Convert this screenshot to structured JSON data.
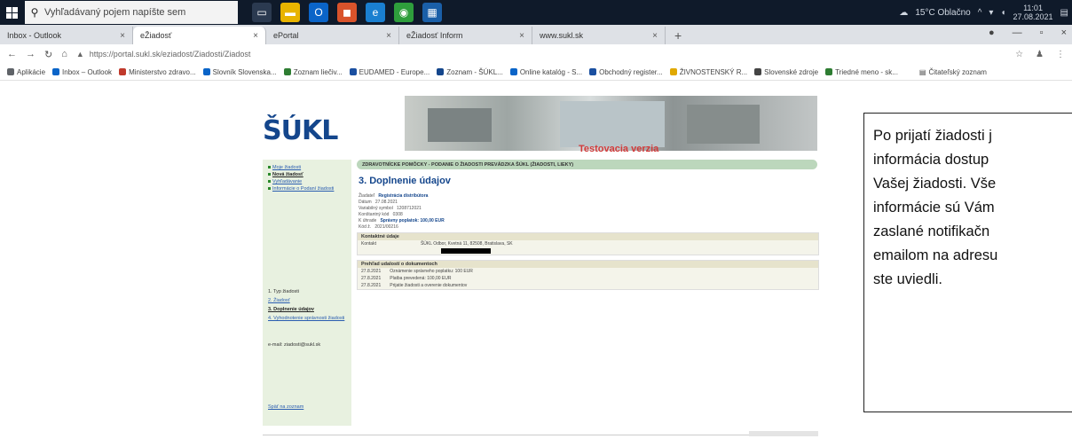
{
  "taskbar": {
    "search_placeholder": "Vyhľadávaný pojem napíšte sem",
    "weather": "15°C Oblačno",
    "time": "11:01",
    "date": "27.08.2021"
  },
  "browser": {
    "tabs": [
      {
        "label": "Inbox - Outlook"
      },
      {
        "label": "eŽiadosť",
        "active": true
      },
      {
        "label": "ePortal"
      },
      {
        "label": "eŽiadosť Inform"
      },
      {
        "label": "www.sukl.sk"
      }
    ],
    "new_tab": "+",
    "url": "https://portal.sukl.sk/eziadost/Ziadosti/Ziadost",
    "bookmarks": [
      {
        "label": "Aplikácie",
        "color": "#5f6368"
      },
      {
        "label": "Inbox – Outlook",
        "color": "#0a64c8"
      },
      {
        "label": "Ministerstvo zdravo...",
        "color": "#c0392b"
      },
      {
        "label": "Slovník Slovenska...",
        "color": "#0a64c8"
      },
      {
        "label": "Zoznam liečiv...",
        "color": "#2e7d32"
      },
      {
        "label": "EUDAMED - Europe...",
        "color": "#1a4fa0"
      },
      {
        "label": "Zoznam - ŠÚKL...",
        "color": "#14468c"
      },
      {
        "label": "Online katalóg - S...",
        "color": "#0a64c8"
      },
      {
        "label": "Obchodný register...",
        "color": "#1a4fa0"
      },
      {
        "label": "ŽIVNOSTENSKÝ R...",
        "color": "#e0a800"
      },
      {
        "label": "Slovenské zdroje",
        "color": "#444444"
      },
      {
        "label": "Triedné meno - sk...",
        "color": "#2e7d32"
      }
    ],
    "reading_list": "Čitateľský zoznam"
  },
  "site": {
    "logo": "ŠÚKL",
    "banner_text": "Testovacia verzia",
    "header_bar": "ZDRAVOTNÍCKE POMÔCKY - PODANIE O ŽIADOSTI PREVÁDZKA ŠÚKL (ŽIADOSTI, LIEKY)",
    "sidebar": {
      "links": [
        "Moje žiadosti",
        "Nová žiadosť",
        "Vyhľadávanie",
        "Informácie o Podaní žiadosti"
      ],
      "steps": [
        "1. Typ žiadosti",
        "2. Žiadosť",
        "3. Doplnenie údajov",
        "4. Vyhodnotenie správnosti žiadosti"
      ],
      "email": "e-mail: ziadosti@sukl.sk",
      "bottom_link": "Späť na zoznam"
    },
    "section_title": "3. Doplnenie údajov",
    "fields": [
      {
        "label": "Žiadateľ",
        "value": "Registrácia distribútora"
      },
      {
        "label": "Dátum",
        "value": "27.08.2021"
      },
      {
        "label": "Variabilný symbol",
        "value": "1208712021"
      },
      {
        "label": "Konštantný kód",
        "value": "0308"
      },
      {
        "label": "K úhrade",
        "value": "Správny poplatok: 100,00 EUR"
      },
      {
        "label": "Kód ž.",
        "value": "2021/00216"
      }
    ],
    "contact_header": "Kontaktné údaje",
    "contact_label": "Kontakt",
    "contact_value": "ŠÚKL Odbor, Kvetná 11, 82508, Bratislava, SK",
    "history_header": "Prehľad udalostí o dokumentoch",
    "history": [
      {
        "date": "27.8.2021",
        "text": "Oznámenie správneho poplatku: 100 EUR"
      },
      {
        "date": "27.8.2021",
        "text": "Platba prevedená: 100,00 EUR"
      },
      {
        "date": "27.8.2021",
        "text": "Prijatie žiadosti a overenie dokumentov"
      }
    ]
  },
  "note": {
    "lines": [
      "Po prijatí žiadosti j",
      "informácia dostup",
      "Vašej žiadosti. Vše",
      "informácie sú Vám",
      "zaslané notifikačn",
      "emailom na adresu",
      "ste uviedli."
    ]
  }
}
